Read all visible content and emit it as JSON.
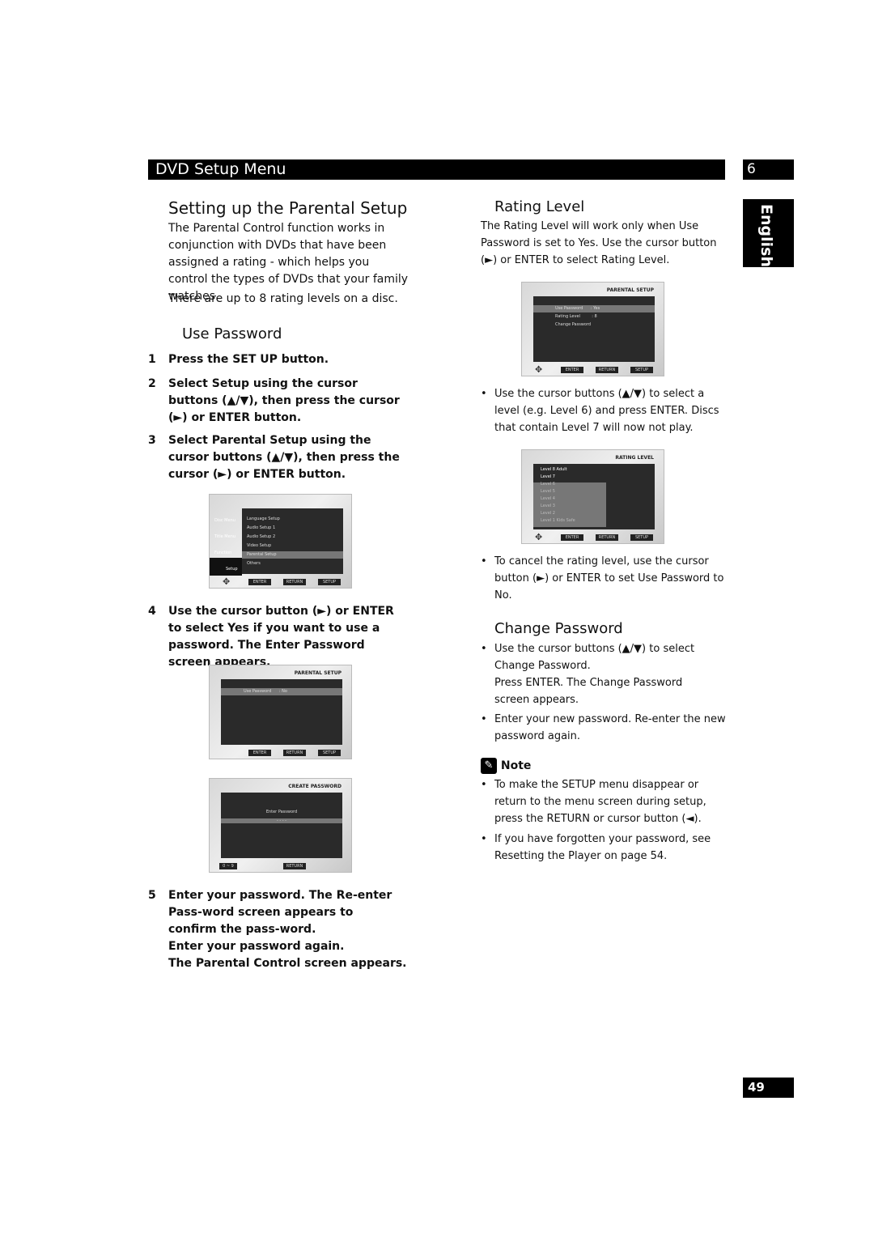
{
  "header": {
    "title": "DVD Setup Menu",
    "chapter": "6",
    "language_tab": "English",
    "page_number": "49"
  },
  "left": {
    "title": "Setting up the Parental Setup",
    "intro": "The Parental Control function works in conjunction with DVDs that have been assigned a rating - which helps you control the types of DVDs that your family watches.",
    "intro2": "There are up to 8 rating levels on a disc.",
    "use_password_heading": "Use Password",
    "steps": [
      {
        "n": "1",
        "text": "Press the SET UP button."
      },
      {
        "n": "2",
        "text": "Select Setup using the cursor buttons (▲/▼), then press the cursor (►) or ENTER button."
      },
      {
        "n": "3",
        "text": "Select Parental Setup using the cursor buttons (▲/▼), then press the cursor (►) or ENTER button."
      },
      {
        "n": "4",
        "text": "Use the cursor button (►) or ENTER to select Yes if you want to use a password. The Enter Password screen appears."
      },
      {
        "n": "5",
        "text": "Enter your password. The Re-enter Pass-word screen appears to confirm the pass-word.",
        "extra1": "Enter your password again.",
        "extra2": "The Parental Control screen appears."
      }
    ]
  },
  "screens": {
    "setup_menu": {
      "side": [
        "Disc Menu",
        "Title Menu",
        "Function",
        "Setup"
      ],
      "items": [
        "Language Setup",
        "Audio Setup 1",
        "Audio Setup 2",
        "Video Setup",
        "Parental Setup",
        "Others"
      ],
      "buttons": [
        "ENTER",
        "RETURN",
        "SETUP"
      ]
    },
    "parental_no": {
      "title": "PARENTAL SETUP",
      "item": "Use Password",
      "value": ": No",
      "buttons": [
        "ENTER",
        "RETURN",
        "SETUP"
      ]
    },
    "create_password": {
      "title": "CREATE PASSWORD",
      "label": "Enter Password",
      "mask": "- - - -",
      "range": "0 ~ 9",
      "button": "RETURN"
    },
    "parental_yes": {
      "title": "PARENTAL SETUP",
      "items": [
        {
          "label": "Use Password",
          "value": ": Yes"
        },
        {
          "label": "Rating Level",
          "value": ": 8"
        },
        {
          "label": "Change Password",
          "value": ""
        }
      ],
      "buttons": [
        "ENTER",
        "RETURN",
        "SETUP"
      ]
    },
    "rating_level": {
      "title": "RATING LEVEL",
      "levels": [
        "Level 8 Adult",
        "Level 7",
        "Level 6",
        "Level 5",
        "Level 4",
        "Level 3",
        "Level 2",
        "Level 1 Kids Safe"
      ],
      "buttons": [
        "ENTER",
        "RETURN",
        "SETUP"
      ]
    }
  },
  "right": {
    "rating_heading": "Rating Level",
    "rating_text": "The Rating Level will work only when Use Password is set to Yes. Use the cursor button (►) or ENTER to select Rating Level.",
    "bullet1": "Use the cursor buttons (▲/▼) to select a level (e.g. Level 6) and press ENTER. Discs that contain Level 7 will now not play.",
    "bullet2": "To cancel the rating level, use the cursor button (►) or ENTER to set Use Password to No.",
    "change_heading": "Change Password",
    "bullet3a": "Use the cursor buttons (▲/▼) to select Change Password.",
    "bullet3b": "Press ENTER. The Change Password screen appears.",
    "bullet4": "Enter your new password. Re-enter the new password again.",
    "note_heading": "Note",
    "note1": "To make the SETUP menu disappear or return to the menu screen during setup, press the RETURN or cursor button (◄).",
    "note2": "If you have forgotten your password, see Resetting the Player on page 54."
  }
}
